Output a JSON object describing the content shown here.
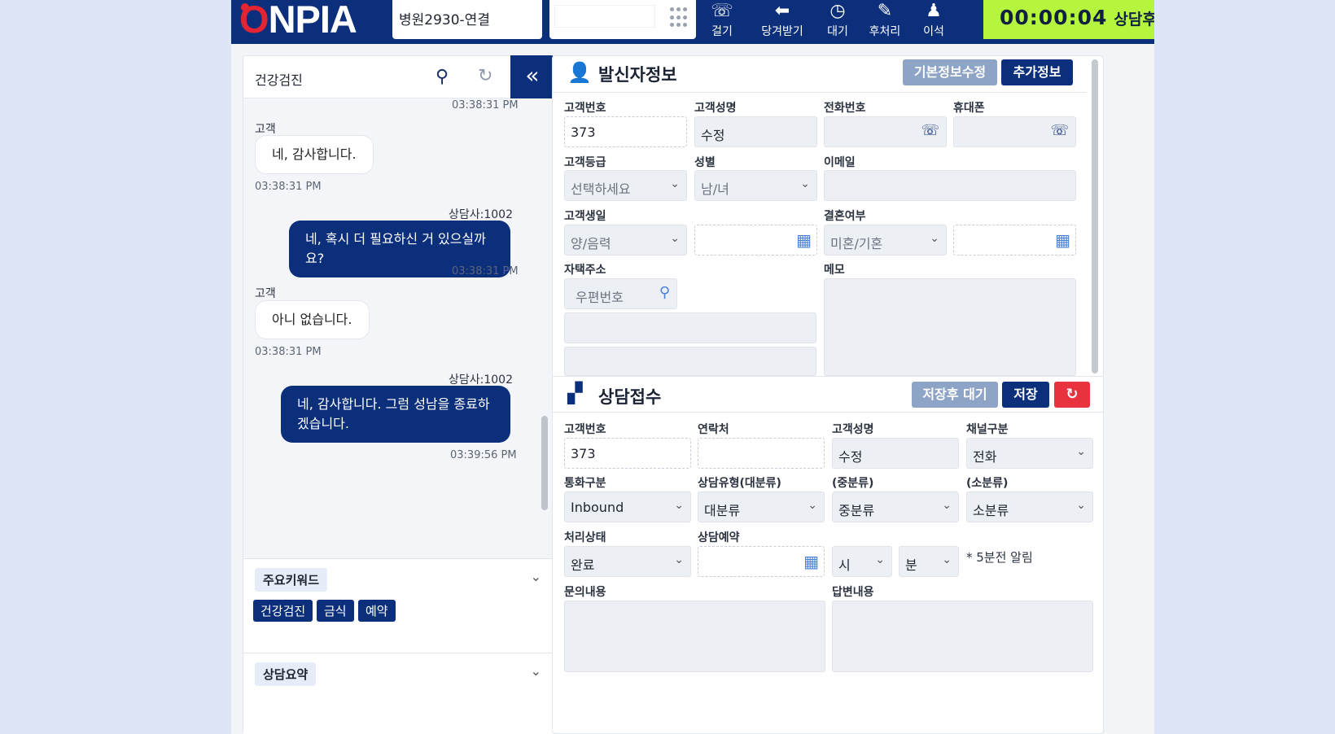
{
  "header": {
    "logo": "ONPIA",
    "line_select": "병원2930-연결",
    "phone_input": "",
    "buttons": [
      {
        "label": "걸기",
        "icon": "phone-out-icon"
      },
      {
        "label": "당겨받기",
        "icon": "pickup-icon"
      },
      {
        "label": "대기",
        "icon": "clock-icon"
      },
      {
        "label": "후처리",
        "icon": "edit-icon"
      },
      {
        "label": "이석",
        "icon": "person-pin-icon"
      }
    ],
    "timer": "00:00:04",
    "status": "상담후처"
  },
  "left": {
    "search_value": "건강검진",
    "chat": [
      {
        "time": "03:38:31 PM"
      },
      {
        "who": "고객",
        "text": "네, 감사합니다.",
        "time": "03:38:31 PM"
      },
      {
        "who": "상담사:1002",
        "text": "네, 혹시 더 필요하신 거 있으실까요?",
        "time": "03:38:31 PM"
      },
      {
        "who": "고객",
        "text": "아니 없습니다.",
        "time": "03:38:31 PM"
      },
      {
        "who": "상담사:1002",
        "text": "네, 감사합니다. 그럼 성남을 종료하겠습니다.",
        "time": "03:39:56 PM"
      }
    ],
    "keywords_title": "주요키워드",
    "keywords": [
      "건강검진",
      "금식",
      "예약"
    ],
    "summary_title": "상담요약"
  },
  "caller": {
    "title": "발신자정보",
    "btn_edit": "기본정보수정",
    "btn_more": "추가정보",
    "labels": {
      "cust_no": "고객번호",
      "cust_name": "고객성명",
      "tel": "전화번호",
      "mobile": "휴대폰",
      "grade": "고객등급",
      "gender": "성별",
      "email": "이메일",
      "birth": "고객생일",
      "marriage": "결혼여부",
      "address": "자택주소",
      "memo": "메모"
    },
    "values": {
      "cust_no": "373",
      "cust_name": "수정",
      "grade": "선택하세요",
      "gender": "남/녀",
      "calendar": "양/음력",
      "marriage": "미혼/기혼",
      "zip_placeholder": "우편번호"
    }
  },
  "consult": {
    "title": "상담접수",
    "btn_save_wait": "저장후 대기",
    "btn_save": "저장",
    "labels": {
      "cust_no": "고객번호",
      "contact": "연락처",
      "cust_name": "고객성명",
      "channel": "채널구분",
      "call_type": "통화구분",
      "type_l": "상담유형(대분류)",
      "type_m": "(중분류)",
      "type_s": "(소분류)",
      "state": "처리상태",
      "reserve": "상담예약",
      "question": "문의내용",
      "answer": "답변내용"
    },
    "values": {
      "cust_no": "373",
      "cust_name": "수정",
      "channel": "전화",
      "call_type": "Inbound",
      "type_l": "대분류",
      "type_m": "중분류",
      "type_s": "소분류",
      "state": "완료",
      "hour": "시",
      "minute": "분"
    },
    "alarm_note": "* 5분전 알림"
  }
}
